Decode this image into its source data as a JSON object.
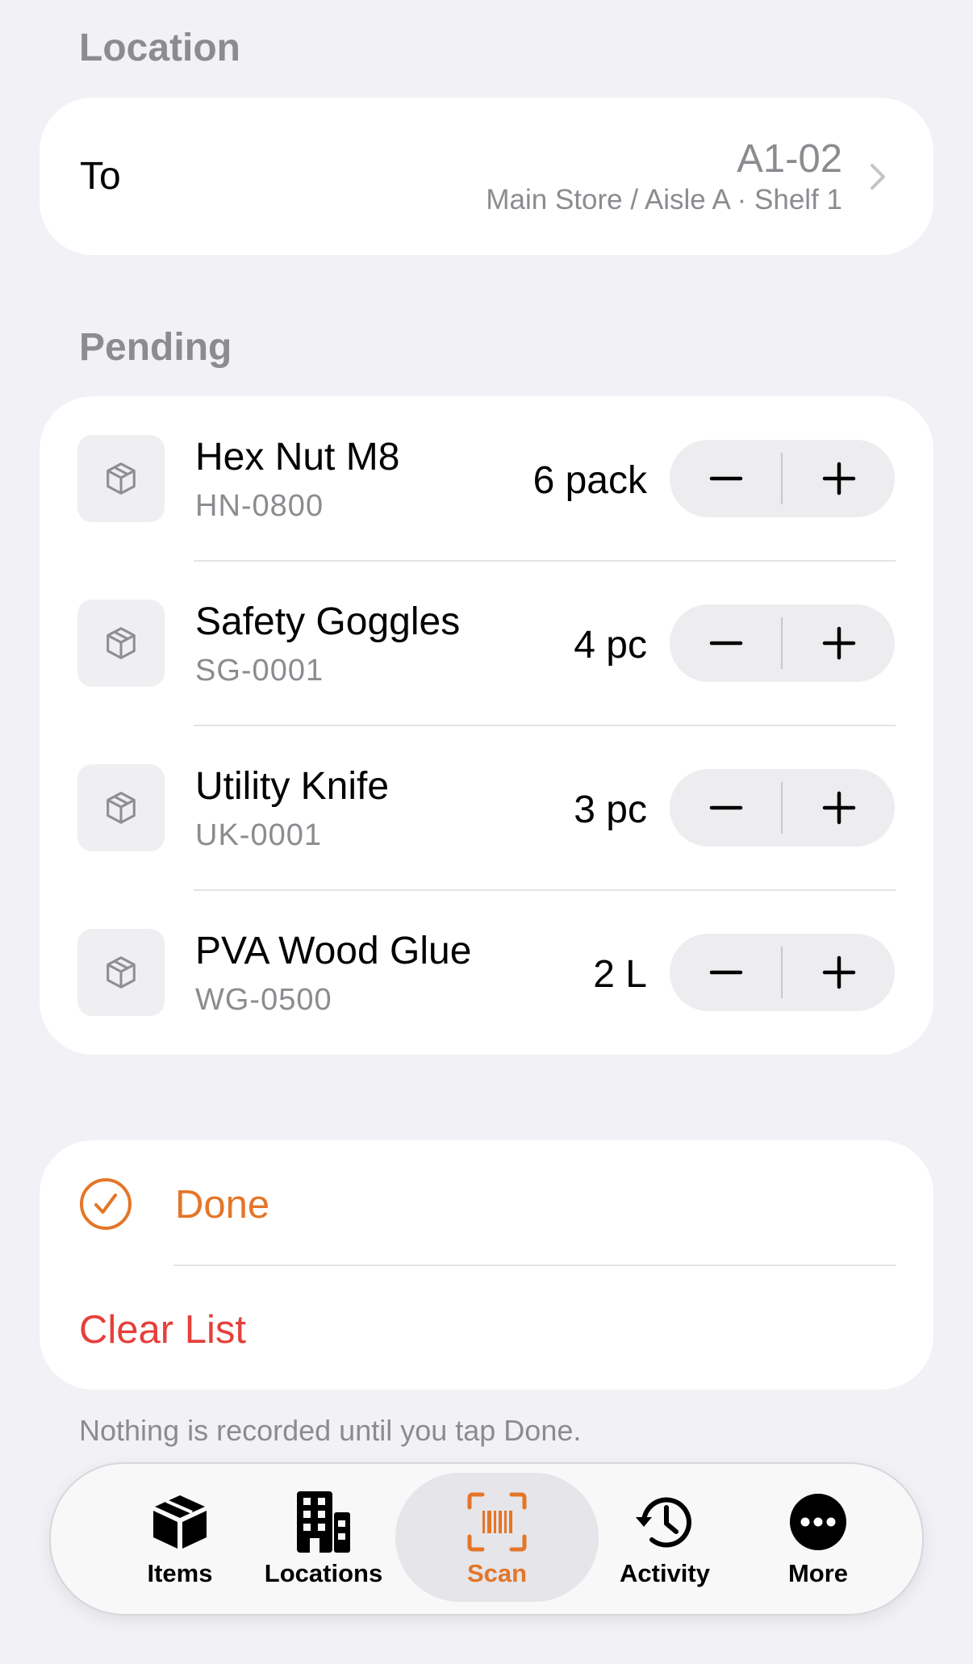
{
  "location": {
    "header": "Location",
    "to_label": "To",
    "code": "A1-02",
    "path": "Main Store / Aisle A · Shelf 1"
  },
  "pending": {
    "header": "Pending",
    "items": [
      {
        "name": "Hex Nut M8",
        "sku": "HN-0800",
        "qty": "6 pack"
      },
      {
        "name": "Safety Goggles",
        "sku": "SG-0001",
        "qty": "4 pc"
      },
      {
        "name": "Utility Knife",
        "sku": "UK-0001",
        "qty": "3 pc"
      },
      {
        "name": "PVA Wood Glue",
        "sku": "WG-0500",
        "qty": "2 L"
      }
    ]
  },
  "actions": {
    "done_label": "Done",
    "clear_label": "Clear List"
  },
  "footnote": "Nothing is recorded until you tap Done.",
  "tabbar": {
    "active": "Scan",
    "tabs": [
      {
        "label": "Items",
        "icon": "box-icon"
      },
      {
        "label": "Locations",
        "icon": "building-icon"
      },
      {
        "label": "Scan",
        "icon": "barcode-scan-icon"
      },
      {
        "label": "Activity",
        "icon": "history-clock-icon"
      },
      {
        "label": "More",
        "icon": "ellipsis-circle-icon"
      }
    ]
  },
  "colors": {
    "accent": "#e47628",
    "destructive": "#e5403c",
    "secondary_text": "#8b8b90",
    "background": "#f1f1f6"
  }
}
